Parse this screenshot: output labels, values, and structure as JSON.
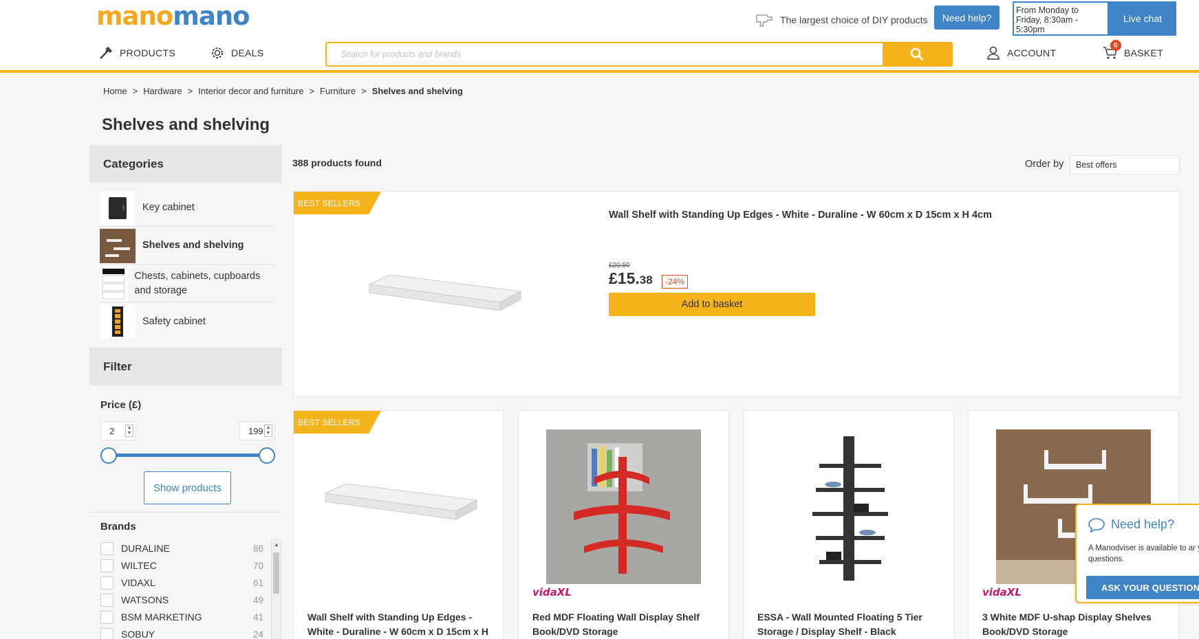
{
  "header": {
    "logo_part1": "mano",
    "logo_part2": "mano",
    "tagline": "The largest choice of DIY products",
    "need_help": "Need help?",
    "hours": "From Monday to Friday, 8:30am - 5:30pm",
    "live_chat": "Live chat",
    "nav": {
      "products": "PRODUCTS",
      "deals": "DEALS",
      "account": "ACCOUNT",
      "basket": "BASKET",
      "basket_count": "0"
    },
    "search_placeholder": "Search for products and brands"
  },
  "breadcrumb": [
    "Home",
    "Hardware",
    "Interior decor and furniture",
    "Furniture",
    "Shelves and shelving"
  ],
  "breadcrumb_sep": ">",
  "page_title": "Shelves and shelving",
  "sidebar": {
    "categories_title": "Categories",
    "categories": [
      {
        "label": "Key cabinet"
      },
      {
        "label": "Shelves and shelving"
      },
      {
        "label": "Chests, cabinets, cupboards and storage"
      },
      {
        "label": "Safety cabinet"
      }
    ],
    "filter_title": "Filter",
    "price_label": "Price (£)",
    "price_min": "2",
    "price_max": "199",
    "price_range_fraction": [
      0,
      1
    ],
    "show_products": "Show products",
    "brands_title": "Brands",
    "brands": [
      {
        "name": "DURALINE",
        "count": "86"
      },
      {
        "name": "WILTEC",
        "count": "70"
      },
      {
        "name": "VIDAXL",
        "count": "61"
      },
      {
        "name": "WATSONS",
        "count": "49"
      },
      {
        "name": "BSM MARKETING",
        "count": "41"
      },
      {
        "name": "SOBUY",
        "count": "24"
      }
    ]
  },
  "results": {
    "count_text": "388 products found",
    "order_label": "Order by",
    "order_value": "Best offers"
  },
  "featured": {
    "badge": "BEST SELLERS",
    "title": "Wall Shelf with Standing Up Edges - White - Duraline - W 60cm x D 15cm x H 4cm",
    "old_price": "£20.50",
    "price_main": "£15.",
    "price_cents": "38",
    "discount": "-24%",
    "add_to_basket": "Add to basket"
  },
  "cards": [
    {
      "badge": "BEST SELLERS",
      "seller": "",
      "title": "Wall Shelf with Standing Up Edges - White - Duraline - W 60cm x D 15cm x H"
    },
    {
      "badge": "",
      "seller": "vidaXL",
      "title": "Red MDF Floating Wall Display Shelf Book/DVD Storage"
    },
    {
      "badge": "",
      "seller": "",
      "title": "ESSA - Wall Mounted Floating 5 Tier Storage / Display Shelf - Black"
    },
    {
      "badge": "",
      "seller": "vidaXL",
      "title": "3 White MDF U-shap Display Shelves Book/DVD Storage"
    }
  ],
  "help_popup": {
    "title": "Need help?",
    "text": "A Manodviser is available to ar your questions.",
    "button": "ASK YOUR QUESTION"
  },
  "colors": {
    "accent_yellow": "#f6b31b",
    "accent_blue": "#3f84c6",
    "discount_red": "#e8461c"
  },
  "icons": [
    "hammer-icon",
    "deals-gear-icon",
    "search-icon",
    "user-icon",
    "basket-icon",
    "drill-icon",
    "chat-bubble-icon"
  ]
}
